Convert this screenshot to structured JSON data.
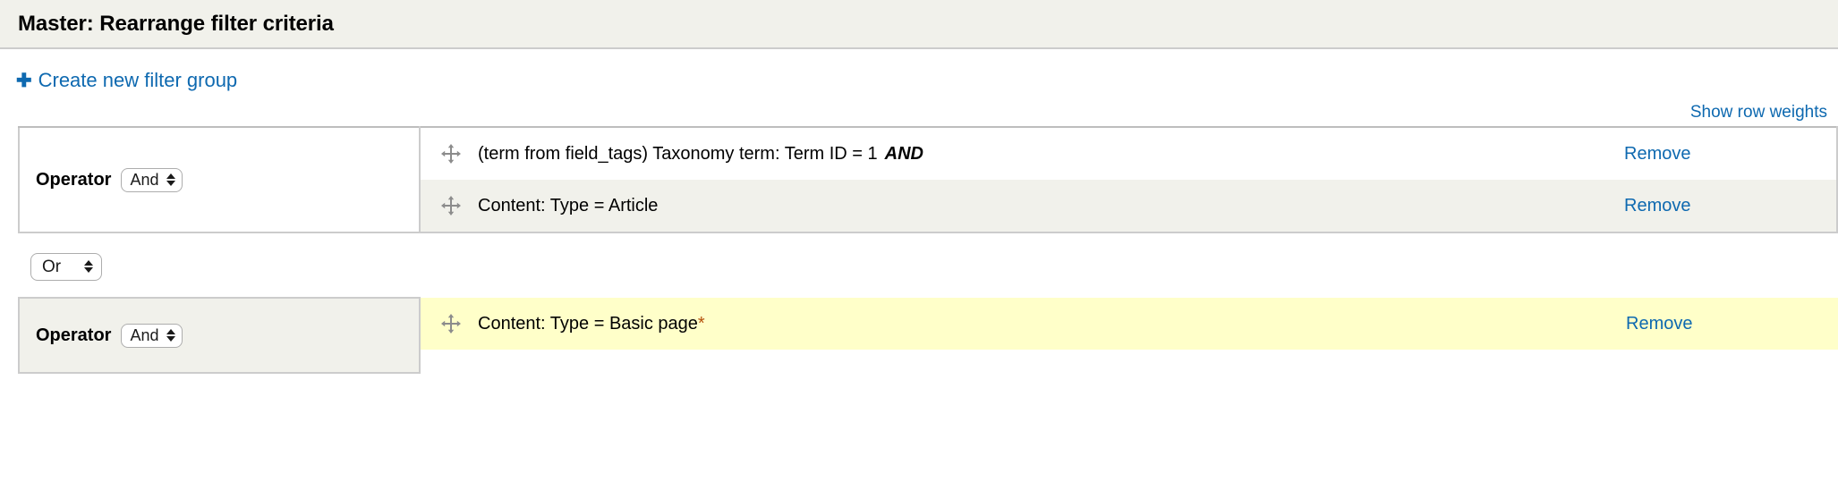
{
  "header": {
    "title": "Master: Rearrange filter criteria"
  },
  "actions": {
    "create_group_label": "Create new filter group",
    "create_group_icon": "plus-icon",
    "show_row_weights_label": "Show row weights"
  },
  "labels": {
    "operator": "Operator",
    "remove": "Remove",
    "drag_icon": "move-cross-icon"
  },
  "colors": {
    "link_blue": "#0e69b0",
    "header_bg": "#f1f1eb",
    "highlight_yellow": "#ffffc9",
    "required_mark": "#b5520c",
    "border_gray": "#cccccc"
  },
  "groups": [
    {
      "operator_label": "Operator",
      "operator_value": "And",
      "criteria": [
        {
          "text": "(term from field_tags) Taxonomy term: Term ID = 1",
          "suffix": "AND",
          "required": false,
          "remove_label": "Remove",
          "style": "white"
        },
        {
          "text": "Content: Type = Article",
          "suffix": "",
          "required": false,
          "remove_label": "Remove",
          "style": "striped"
        }
      ]
    },
    {
      "operator_label": "Operator",
      "operator_value": "And",
      "criteria": [
        {
          "text": "Content: Type = Basic page",
          "suffix": "",
          "required": true,
          "required_mark": "*",
          "remove_label": "Remove",
          "style": "highlight"
        }
      ]
    }
  ],
  "group_join": {
    "value": "Or"
  }
}
